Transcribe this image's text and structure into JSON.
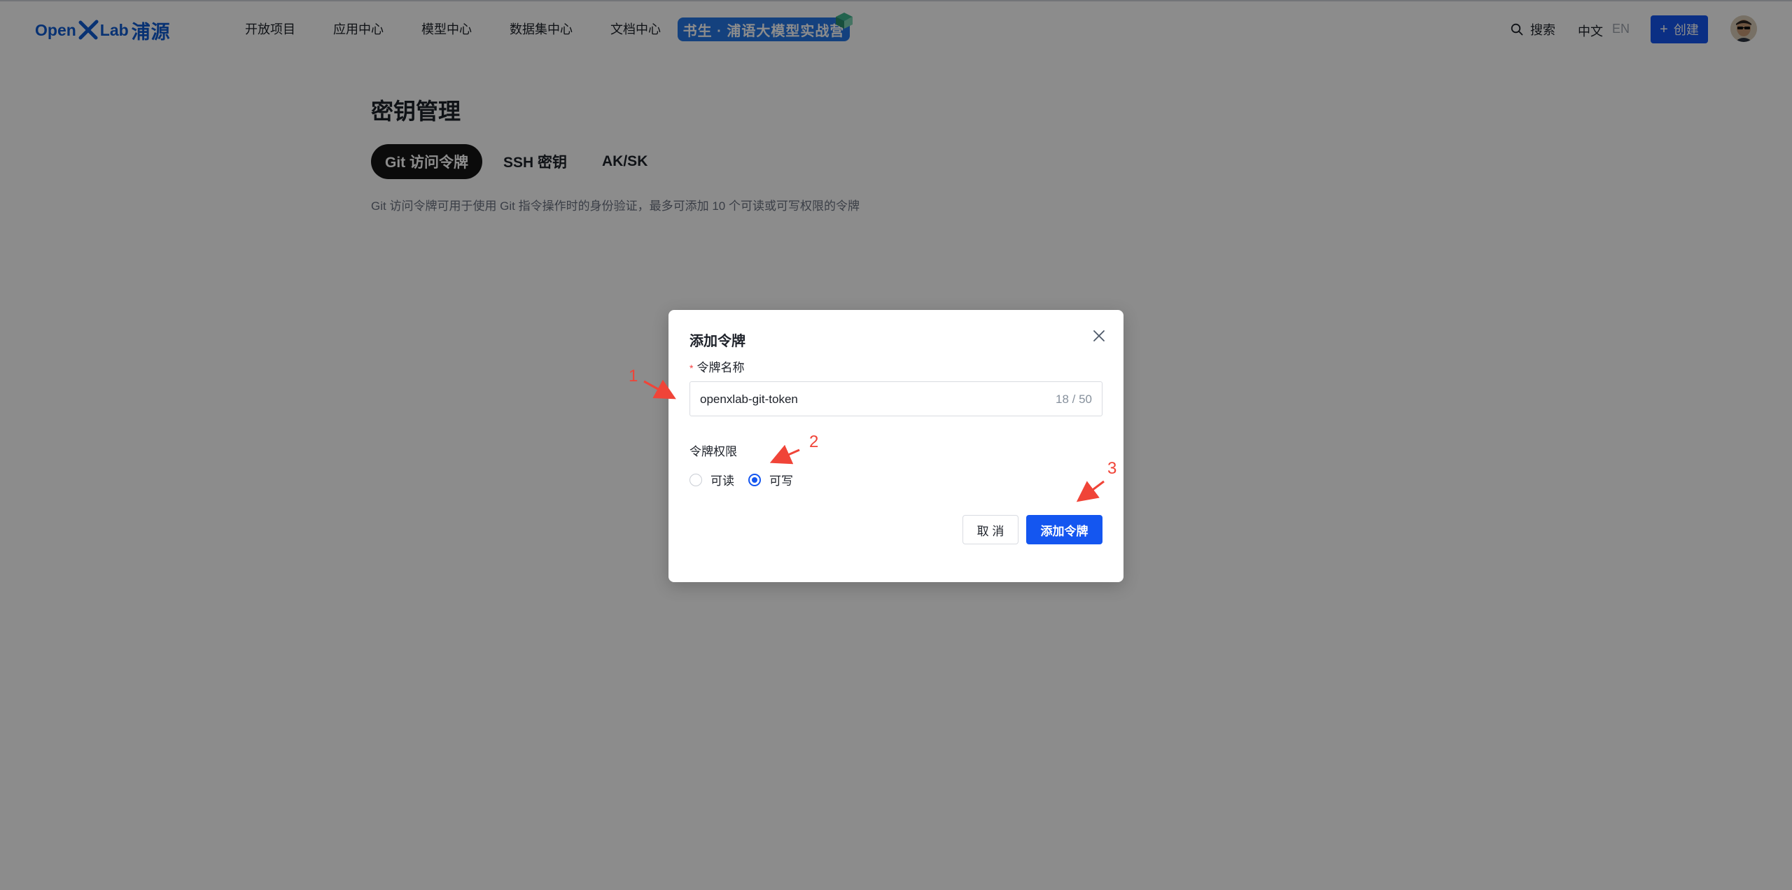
{
  "header": {
    "logo": {
      "open": "Open",
      "lab": "Lab",
      "cn": "浦源"
    },
    "nav": [
      {
        "label": "开放项目"
      },
      {
        "label": "应用中心"
      },
      {
        "label": "模型中心"
      },
      {
        "label": "数据集中心"
      },
      {
        "label": "文档中心"
      }
    ],
    "banner": "书生 · 浦语大模型实战营",
    "search_label": "搜索",
    "lang_zh": "中文",
    "lang_en": "EN",
    "create_label": "创建"
  },
  "page": {
    "title": "密钥管理",
    "tabs": [
      {
        "label": "Git 访问令牌",
        "active": true
      },
      {
        "label": "SSH 密钥",
        "active": false
      },
      {
        "label": "AK/SK",
        "active": false
      }
    ],
    "description": "Git 访问令牌可用于使用 Git 指令操作时的身份验证，最多可添加 10 个可读或可写权限的令牌"
  },
  "modal": {
    "title": "添加令牌",
    "name_label": "令牌名称",
    "name_required_mark": "*",
    "name_value": "openxlab-git-token",
    "name_count": "18 / 50",
    "permission_label": "令牌权限",
    "permissions": [
      {
        "label": "可读",
        "checked": false
      },
      {
        "label": "可写",
        "checked": true
      }
    ],
    "cancel_label": "取 消",
    "submit_label": "添加令牌"
  },
  "annotations": [
    {
      "label": "1"
    },
    {
      "label": "2"
    },
    {
      "label": "3"
    }
  ],
  "colors": {
    "brand": "#1456f0",
    "annotation": "#f04438",
    "overlay": "rgba(0,0,0,0.45)"
  }
}
